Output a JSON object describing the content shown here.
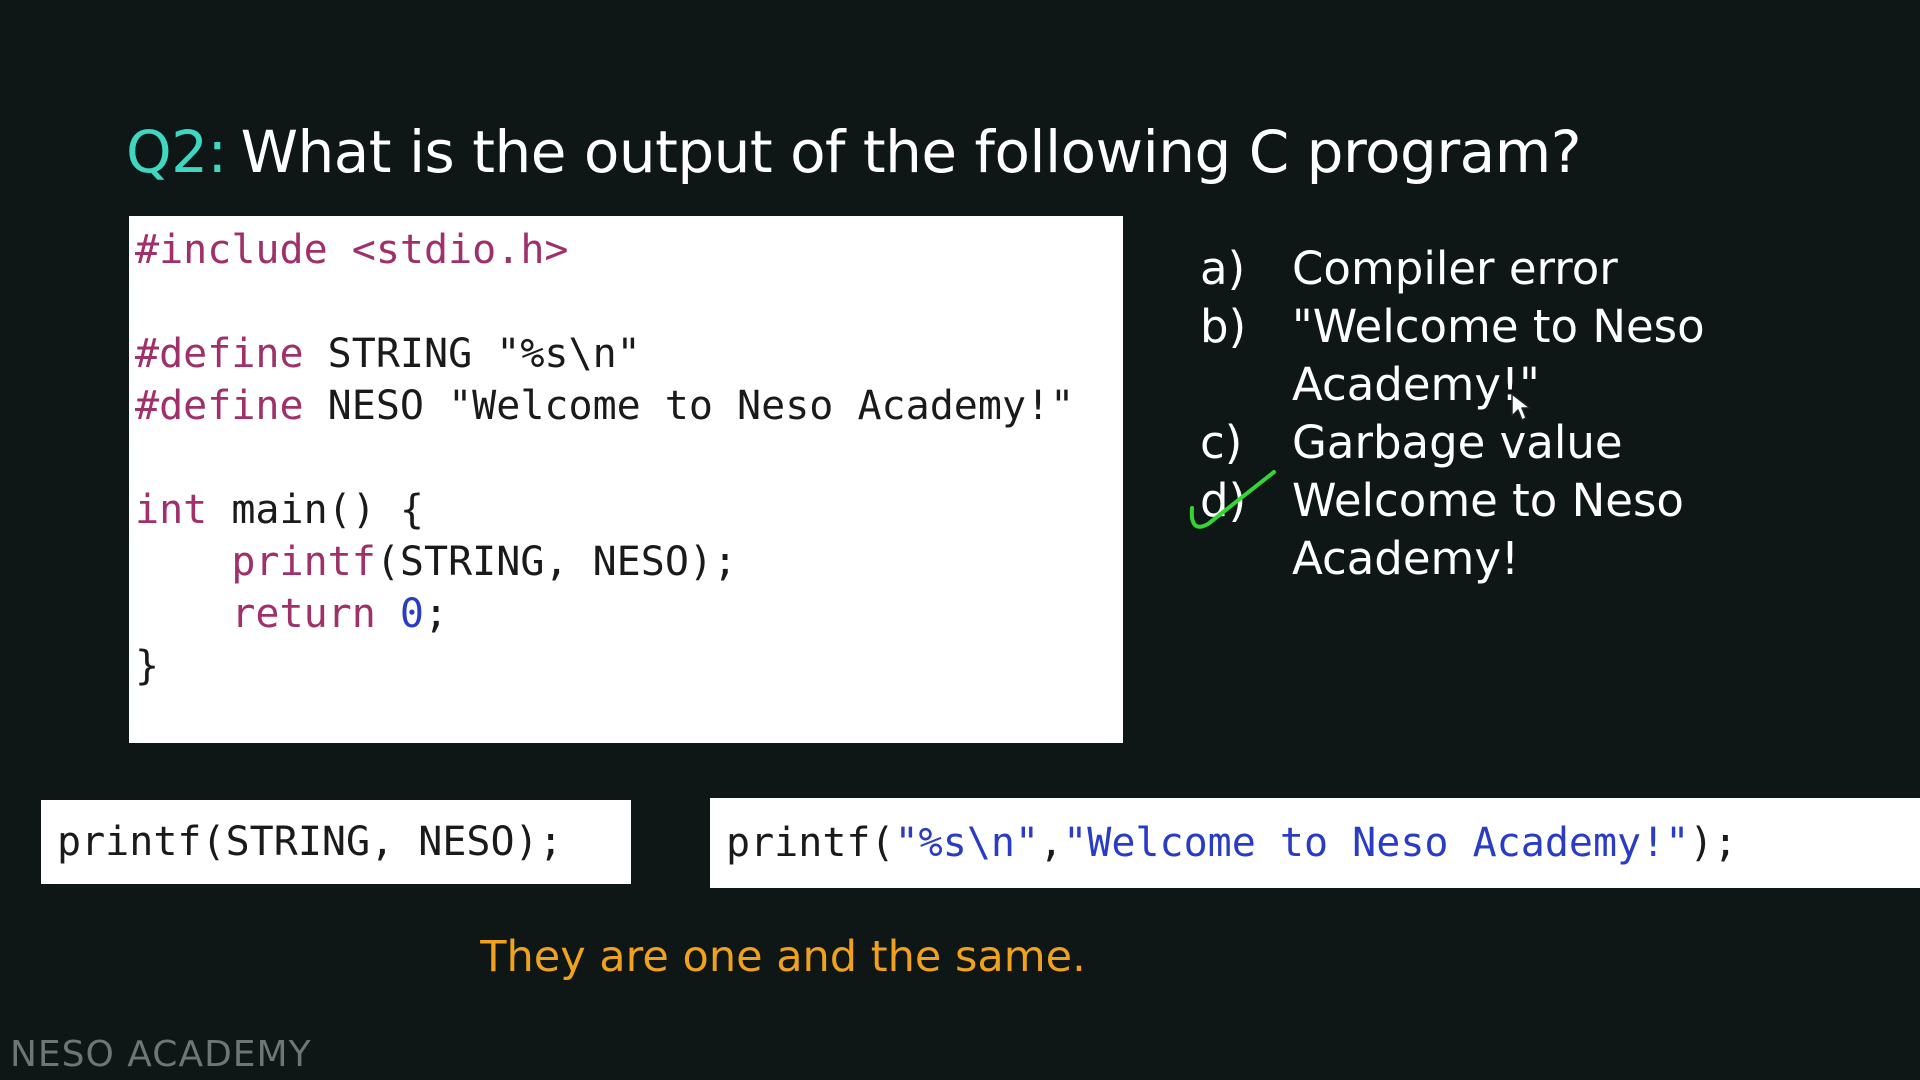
{
  "question": {
    "number": "Q2:",
    "text": "What is the output of the following C program?"
  },
  "code_lines": {
    "line1": "#include <stdio.h>",
    "line2_kw": "#define",
    "line2_rest": " STRING \"%s\\n\"",
    "line3_kw": "#define",
    "line3_rest": " NESO \"Welcome to Neso Academy!\"",
    "line4_kw": "int",
    "line4_rest": " main() {",
    "line5_kw": "printf",
    "line5_rest": "(STRING, NESO);",
    "line6_kw": "return",
    "line6_num": "0",
    "line6_rest": ";",
    "line7": "}"
  },
  "options": [
    {
      "letter": "a)",
      "text": "Compiler error"
    },
    {
      "letter": "b)",
      "text": "\"Welcome to Neso Academy!\""
    },
    {
      "letter": "c)",
      "text": "Garbage value"
    },
    {
      "letter": "d)",
      "text": "Welcome to Neso Academy!",
      "marked_correct": true
    }
  ],
  "comparison": {
    "left": "printf(STRING, NESO);",
    "right_fn": "printf(",
    "right_arg1": "\"%s\\n\"",
    "right_sep": ", ",
    "right_arg2": "\"Welcome to Neso Academy!\"",
    "right_end": ");"
  },
  "caption": "They are one and the same.",
  "watermark": "NESO ACADEMY",
  "colors": {
    "background": "#0e1716",
    "question_number": "#3fd6c2",
    "keyword": "#a0306a",
    "number_literal": "#2a3cc4",
    "caption": "#f0a21e",
    "checkmark": "#33d633"
  }
}
